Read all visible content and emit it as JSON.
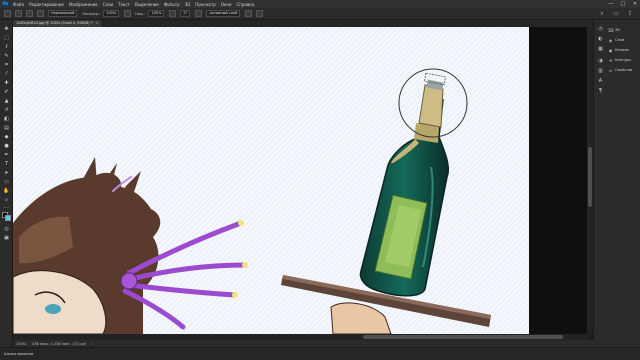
{
  "menubar": {
    "app_logo": "Ps",
    "items": [
      "Файл",
      "Редактирование",
      "Изображение",
      "Слои",
      "Текст",
      "Выделение",
      "Фильтр",
      "3D",
      "Просмотр",
      "Окно",
      "Справка"
    ],
    "window_controls": [
      "—",
      "□",
      "✕"
    ]
  },
  "options": {
    "mode_label": "Нормальный",
    "opacity_label": "Непрозр.:",
    "opacity_value": "100%",
    "flow_label": "Наж.:",
    "flow_value": "100%",
    "angle_value": "0°",
    "sample_value": "Активный слой"
  },
  "document": {
    "tab_title": "1083sjfvR24.jpg @ 100% (Слой 2, RGB/8) *",
    "close": "×"
  },
  "status": {
    "zoom": "100%",
    "size": "436 пикс. x 236 пикс. (72 ppi)"
  },
  "timeline": {
    "label": "Шкала времени"
  },
  "right_panel": {
    "items": [
      {
        "icon": "3D",
        "label": "3D"
      },
      {
        "icon": "◈",
        "label": "Слои"
      },
      {
        "icon": "◉",
        "label": "Каналы"
      },
      {
        "icon": "⟲",
        "label": "Контуры"
      },
      {
        "icon": "≡",
        "label": "Свойства"
      }
    ]
  },
  "colors": {
    "foreground": "#0a0a0a",
    "background": "#4fd3e8",
    "canvas": "#f4f7fb"
  }
}
